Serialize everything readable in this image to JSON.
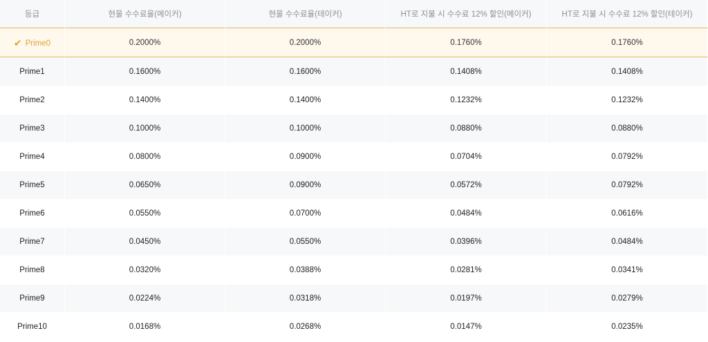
{
  "table": {
    "headers": [
      "등급",
      "현물 수수료율(메이커)",
      "현물 수수료율(테이커)",
      "HT로 지불 시 수수료 12% 할인(메이커)",
      "HT로 지불 시 수수료 12% 할인(테이커)"
    ],
    "rows": [
      {
        "tier": "Prime0",
        "maker": "0.2000%",
        "taker": "0.2000%",
        "ht_maker": "0.1760%",
        "ht_taker": "0.1760%",
        "selected": true
      },
      {
        "tier": "Prime1",
        "maker": "0.1600%",
        "taker": "0.1600%",
        "ht_maker": "0.1408%",
        "ht_taker": "0.1408%"
      },
      {
        "tier": "Prime2",
        "maker": "0.1400%",
        "taker": "0.1400%",
        "ht_maker": "0.1232%",
        "ht_taker": "0.1232%"
      },
      {
        "tier": "Prime3",
        "maker": "0.1000%",
        "taker": "0.1000%",
        "ht_maker": "0.0880%",
        "ht_taker": "0.0880%"
      },
      {
        "tier": "Prime4",
        "maker": "0.0800%",
        "taker": "0.0900%",
        "ht_maker": "0.0704%",
        "ht_taker": "0.0792%"
      },
      {
        "tier": "Prime5",
        "maker": "0.0650%",
        "taker": "0.0900%",
        "ht_maker": "0.0572%",
        "ht_taker": "0.0792%"
      },
      {
        "tier": "Prime6",
        "maker": "0.0550%",
        "taker": "0.0700%",
        "ht_maker": "0.0484%",
        "ht_taker": "0.0616%"
      },
      {
        "tier": "Prime7",
        "maker": "0.0450%",
        "taker": "0.0550%",
        "ht_maker": "0.0396%",
        "ht_taker": "0.0484%"
      },
      {
        "tier": "Prime8",
        "maker": "0.0320%",
        "taker": "0.0388%",
        "ht_maker": "0.0281%",
        "ht_taker": "0.0341%"
      },
      {
        "tier": "Prime9",
        "maker": "0.0224%",
        "taker": "0.0318%",
        "ht_maker": "0.0197%",
        "ht_taker": "0.0279%"
      },
      {
        "tier": "Prime10",
        "maker": "0.0168%",
        "taker": "0.0268%",
        "ht_maker": "0.0147%",
        "ht_taker": "0.0235%"
      }
    ],
    "selected_icon": "check-icon",
    "colors": {
      "accent": "#e3a02f",
      "header_bg": "#f7f8f9",
      "header_text": "#8c8f94",
      "selected_bg": "#fef8ed",
      "stripe_bg": "#f7f8f9"
    }
  }
}
